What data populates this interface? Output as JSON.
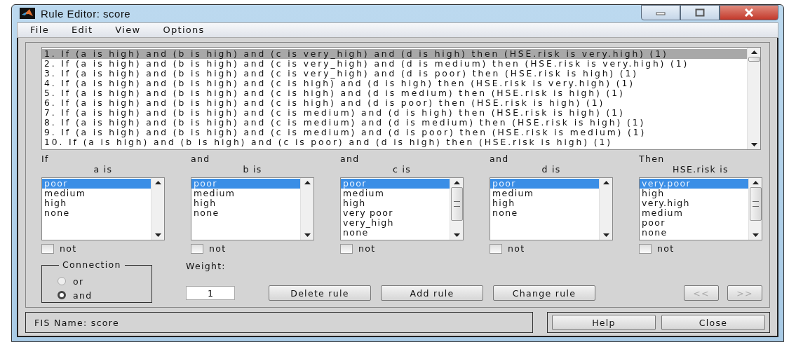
{
  "window": {
    "title": "Rule Editor: score"
  },
  "menu": [
    "File",
    "Edit",
    "View",
    "Options"
  ],
  "rules": [
    {
      "text": "1. If (a is high) and (b is high) and (c is very_high) and (d is high) then (HSE.risk is very.high) (1)",
      "selected": true
    },
    {
      "text": "2. If (a is high) and (b is high) and (c is very_high) and (d is medium) then (HSE.risk is very.high) (1)",
      "selected": false
    },
    {
      "text": "3. If (a is high) and (b is high) and (c is very_high) and (d is poor) then (HSE.risk is high) (1)",
      "selected": false
    },
    {
      "text": "4. If (a is high) and (b is high) and (c is high) and (d is high) then (HSE.risk is very.high) (1)",
      "selected": false
    },
    {
      "text": "5. If (a is high) and (b is high) and (c is high) and (d is medium) then (HSE.risk is high) (1)",
      "selected": false
    },
    {
      "text": "6. If (a is high) and (b is high) and (c is high) and (d is poor) then (HSE.risk is high) (1)",
      "selected": false
    },
    {
      "text": "7. If (a is high) and (b is high) and (c is medium) and (d is high) then (HSE.risk is high) (1)",
      "selected": false
    },
    {
      "text": "8. If (a is high) and (b is high) and (c is medium) and (d is medium) then (HSE.risk is high) (1)",
      "selected": false
    },
    {
      "text": "9. If (a is high) and (b is high) and (c is medium) and (d is poor) then (HSE.risk is medium) (1)",
      "selected": false
    },
    {
      "text": "10. If (a is high) and (b is high) and (c is poor) and (d is high) then (HSE.risk is high) (1)",
      "selected": false
    }
  ],
  "variables": [
    {
      "connector": "If",
      "label": "a is",
      "not_checked": false,
      "not_label": "not",
      "options": [
        {
          "label": "poor",
          "selected": true
        },
        {
          "label": "medium",
          "selected": false
        },
        {
          "label": "high",
          "selected": false
        },
        {
          "label": "none",
          "selected": false
        }
      ]
    },
    {
      "connector": "and",
      "label": "b is",
      "not_checked": false,
      "not_label": "not",
      "options": [
        {
          "label": "poor",
          "selected": true
        },
        {
          "label": "medium",
          "selected": false
        },
        {
          "label": "high",
          "selected": false
        },
        {
          "label": "none",
          "selected": false
        }
      ]
    },
    {
      "connector": "and",
      "label": "c is",
      "not_checked": false,
      "not_label": "not",
      "options": [
        {
          "label": "poor",
          "selected": true
        },
        {
          "label": "medium",
          "selected": false
        },
        {
          "label": "high",
          "selected": false
        },
        {
          "label": "very poor",
          "selected": false
        },
        {
          "label": "very_high",
          "selected": false
        },
        {
          "label": "none",
          "selected": false
        }
      ]
    },
    {
      "connector": "and",
      "label": "d is",
      "not_checked": false,
      "not_label": "not",
      "options": [
        {
          "label": "poor",
          "selected": true
        },
        {
          "label": "medium",
          "selected": false
        },
        {
          "label": "high",
          "selected": false
        },
        {
          "label": "none",
          "selected": false
        }
      ]
    },
    {
      "connector": "Then",
      "label": "HSE.risk is",
      "not_checked": false,
      "not_label": "not",
      "options": [
        {
          "label": "very.poor",
          "selected": true
        },
        {
          "label": "high",
          "selected": false
        },
        {
          "label": "very.high",
          "selected": false
        },
        {
          "label": "medium",
          "selected": false
        },
        {
          "label": "poor",
          "selected": false
        },
        {
          "label": "none",
          "selected": false
        }
      ]
    }
  ],
  "connection": {
    "title": "Connection",
    "options": [
      {
        "label": "or",
        "selected": false
      },
      {
        "label": "and",
        "selected": true
      }
    ]
  },
  "weight": {
    "label": "Weight:",
    "value": "1"
  },
  "buttons": [
    {
      "label": "Delete rule",
      "disabled": false
    },
    {
      "label": "Add rule",
      "disabled": false
    },
    {
      "label": "Change rule",
      "disabled": false
    }
  ],
  "nav_buttons": [
    {
      "label": "<<",
      "disabled": true
    },
    {
      "label": ">>",
      "disabled": true
    }
  ],
  "status": "FIS Name: score",
  "footer_buttons": [
    "Help",
    "Close"
  ]
}
